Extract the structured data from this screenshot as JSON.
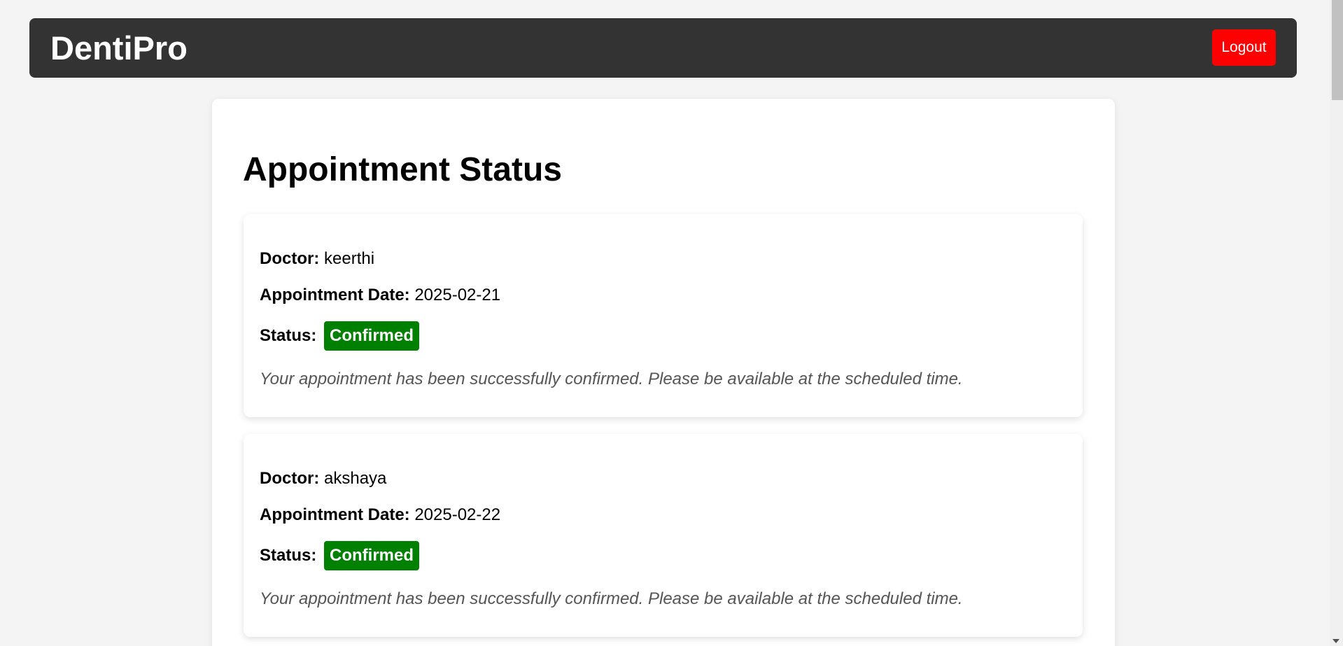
{
  "header": {
    "brand": "DentiPro",
    "logout_label": "Logout"
  },
  "main": {
    "title": "Appointment Status",
    "labels": {
      "doctor": "Doctor:",
      "date": "Appointment Date:",
      "status": "Status:"
    },
    "appointments": [
      {
        "doctor": "keerthi",
        "date": "2025-02-21",
        "status": "Confirmed",
        "message": "Your appointment has been successfully confirmed. Please be available at the scheduled time."
      },
      {
        "doctor": "akshaya",
        "date": "2025-02-22",
        "status": "Confirmed",
        "message": "Your appointment has been successfully confirmed. Please be available at the scheduled time."
      }
    ]
  },
  "colors": {
    "navbar_bg": "#333333",
    "logout_bg": "#ff0000",
    "status_confirmed": "#008000",
    "page_bg": "#f4f4f4"
  },
  "icons": {
    "scroll_down": "scroll-down-arrow-icon"
  }
}
